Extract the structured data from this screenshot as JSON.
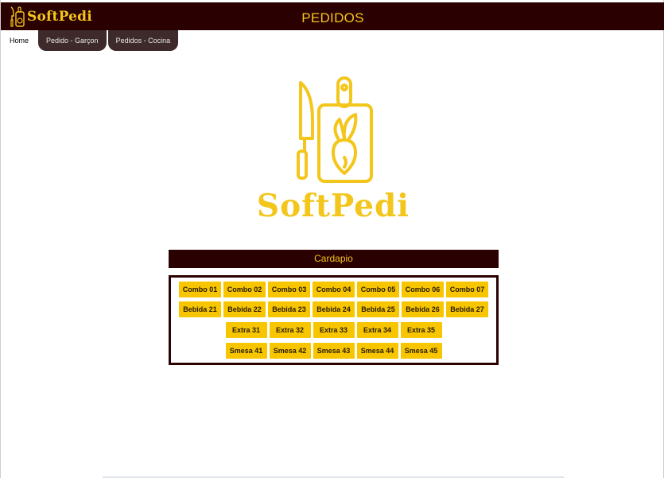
{
  "app": {
    "brand": "SoftPedi",
    "title": "PEDIDOS"
  },
  "nav": {
    "home": "Home",
    "tabs": [
      "Pedido - Garçon",
      "Pedidos - Cocina"
    ]
  },
  "hero": {
    "name": "SoftPedi"
  },
  "cardapio": {
    "title": "Cardapio",
    "rows": [
      [
        "Combo 01",
        "Combo 02",
        "Combo 03",
        "Combo 04",
        "Combo 05",
        "Combo 06",
        "Combo 07"
      ],
      [
        "Bebida 21",
        "Bebida 22",
        "Bebida 23",
        "Bebida 24",
        "Bebida 25",
        "Bebida 26",
        "Bebida 27"
      ],
      [
        "Extra 31",
        "Extra 32",
        "Extra 33",
        "Extra 34",
        "Extra 35"
      ],
      [
        "Smesa 41",
        "Smesa 42",
        "Smesa 43",
        "Smesa 44",
        "Smesa 45"
      ]
    ]
  },
  "colors": {
    "header_bg": "#2b0000",
    "accent": "#f3c61c",
    "button": "#f7c600",
    "tab_bg": "#3e2a2a"
  },
  "icons": {
    "brand_logo": "knife-cutting-board-beet-icon"
  }
}
